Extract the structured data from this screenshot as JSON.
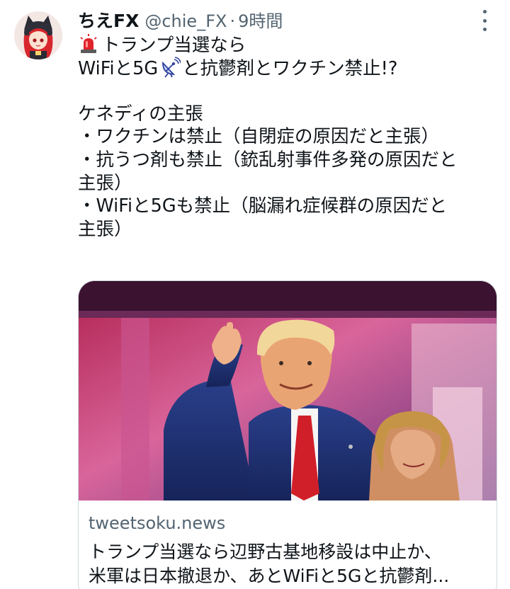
{
  "tweet": {
    "display_name": "ちえFX",
    "handle": "@chie_FX",
    "separator": "·",
    "time": "9時間",
    "lines": [
      "トランプ当選なら",
      "WiFiと5G",
      "と抗鬱剤とワクチン禁止!?",
      "",
      "ケネディの主張",
      "・ワクチンは禁止（自閉症の原因だと主張）",
      "・抗うつ剤も禁止（銃乱射事件多発の原因だと",
      "主張）",
      "・WiFiと5Gも禁止（脳漏れ症候群の原因だと",
      "主張）"
    ],
    "icons": {
      "siren": "rotating-light-icon",
      "satellite": "satellite-antenna-icon",
      "more": "more-options-icon"
    }
  },
  "card": {
    "domain": "tweetsoku.news",
    "title_lines": [
      "トランプ当選なら辺野古基地移設は中止か、",
      "米軍は日本撤退か、あとWiFiと5Gと抗鬱剤..."
    ]
  },
  "colors": {
    "text": "#0f1419",
    "secondary": "#536471",
    "border": "#cfd9de",
    "siren_red": "#e0242c"
  }
}
